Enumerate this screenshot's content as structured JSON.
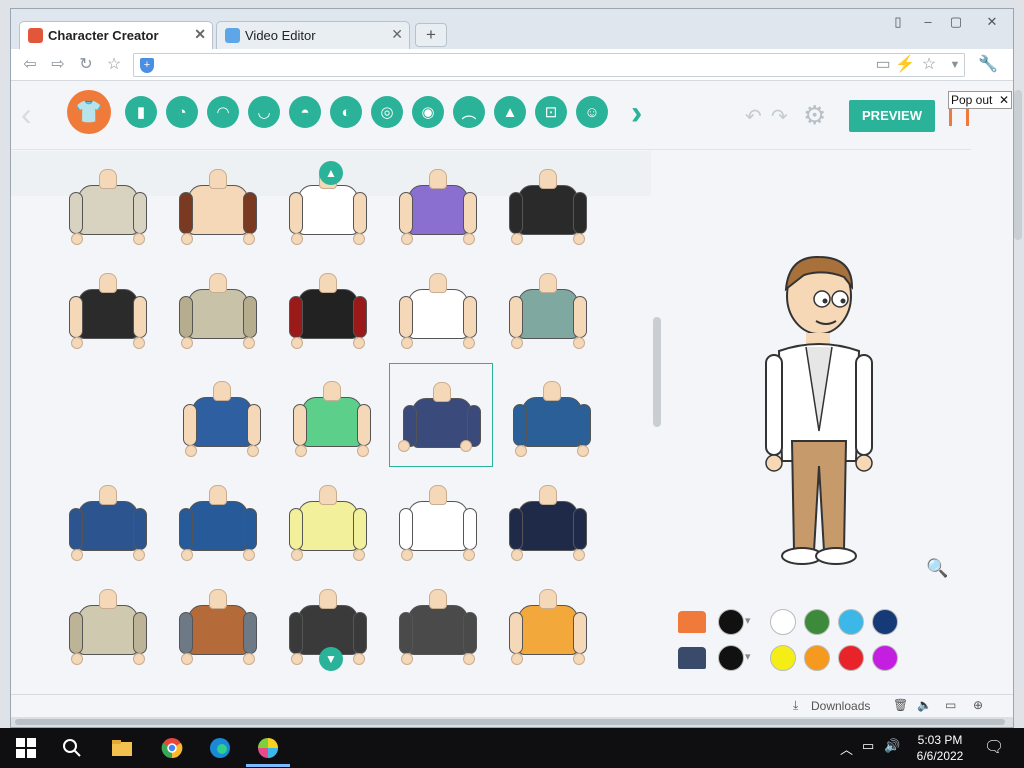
{
  "browser": {
    "tabs": [
      {
        "title": "Character Creator",
        "active": true,
        "favicon_color": "#e2573b"
      },
      {
        "title": "Video Editor",
        "active": false,
        "favicon_color": "#5fa6e8"
      }
    ],
    "new_tab_label": "+",
    "window_controls": [
      "▯",
      "–",
      "▢",
      "✕"
    ]
  },
  "nav": {
    "back": "⇦",
    "forward": "⇨",
    "reload": "↻",
    "bookmark": "☆",
    "url": "",
    "right_icons": [
      "▭",
      "⚡",
      "☆",
      "▼",
      "🔧"
    ]
  },
  "app": {
    "categories": [
      {
        "name": "shirt",
        "glyph": "👕",
        "active": true
      },
      {
        "name": "pants",
        "glyph": "▮"
      },
      {
        "name": "face",
        "glyph": "◔"
      },
      {
        "name": "hair",
        "glyph": "◠"
      },
      {
        "name": "beard",
        "glyph": "◡"
      },
      {
        "name": "mouth",
        "glyph": "◓"
      },
      {
        "name": "ear",
        "glyph": "◐"
      },
      {
        "name": "nose",
        "glyph": "◎"
      },
      {
        "name": "eye",
        "glyph": "◉"
      },
      {
        "name": "eyebrow",
        "glyph": "︵"
      },
      {
        "name": "body",
        "glyph": "▲"
      },
      {
        "name": "glasses",
        "glyph": "⊡"
      },
      {
        "name": "accessory",
        "glyph": "☺"
      }
    ],
    "undo": "↶",
    "redo": "↷",
    "gear": "⚙",
    "preview_label": "PREVIEW",
    "popout_label": "Pop out",
    "popout_close": "✕",
    "scroll_up": "▲",
    "scroll_down": "▼",
    "zoom": "🔍",
    "outfits": [
      {
        "shirt": "#d8d2c0",
        "arm": "#d8d2c0",
        "row": 0,
        "col": 0
      },
      {
        "shirt": "#f4d8b8",
        "arm": "#7a3a22",
        "row": 0,
        "col": 1
      },
      {
        "shirt": "#ffffff",
        "arm": "#f4d8b8",
        "row": 0,
        "col": 2
      },
      {
        "shirt": "#8a6fd1",
        "arm": "#f4d8b8",
        "row": 0,
        "col": 3
      },
      {
        "shirt": "#2a2a2a",
        "arm": "#2a2a2a",
        "row": 0,
        "col": 4
      },
      {
        "shirt": "#2b2b2b",
        "arm": "#f4d8b8",
        "row": 1,
        "col": 0
      },
      {
        "shirt": "#c8c2a8",
        "arm": "#b6ad8e",
        "row": 1,
        "col": 1
      },
      {
        "shirt": "#222222",
        "arm": "#9a1a1a",
        "row": 1,
        "col": 2
      },
      {
        "shirt": "#ffffff",
        "arm": "#f4d8b8",
        "row": 1,
        "col": 3
      },
      {
        "shirt": "#7fa8a0",
        "arm": "#f4d8b8",
        "row": 1,
        "col": 4
      },
      {
        "shirt": "#2e5fa0",
        "arm": "#f4d8b8",
        "row": 2,
        "col": 1
      },
      {
        "shirt": "#5ccf8a",
        "arm": "#f4d8b8",
        "row": 2,
        "col": 2
      },
      {
        "shirt": "#3a4a7a",
        "arm": "#3a4a7a",
        "row": 2,
        "col": 3,
        "selected": true
      },
      {
        "shirt": "#2a5f98",
        "arm": "#2a5f98",
        "row": 2,
        "col": 4
      },
      {
        "shirt": "#2c5590",
        "arm": "#2c5590",
        "row": 3,
        "col": 0
      },
      {
        "shirt": "#275a98",
        "arm": "#275a98",
        "row": 3,
        "col": 1
      },
      {
        "shirt": "#f2f09a",
        "arm": "#f2f09a",
        "row": 3,
        "col": 2
      },
      {
        "shirt": "#ffffff",
        "arm": "#ffffff",
        "row": 3,
        "col": 3
      },
      {
        "shirt": "#1e2a48",
        "arm": "#1e2a48",
        "row": 3,
        "col": 4
      },
      {
        "shirt": "#cfc9b0",
        "arm": "#bdb396",
        "row": 4,
        "col": 0
      },
      {
        "shirt": "#b56a3a",
        "arm": "#6d7a86",
        "row": 4,
        "col": 1
      },
      {
        "shirt": "#3a3a3a",
        "arm": "#3a3a3a",
        "row": 4,
        "col": 2
      },
      {
        "shirt": "#4a4a4a",
        "arm": "#4a4a4a",
        "row": 4,
        "col": 3
      },
      {
        "shirt": "#f2a83a",
        "arm": "#f4d8b8",
        "row": 4,
        "col": 4
      }
    ],
    "swatch_rows": [
      {
        "icon_color": "#f07a3a",
        "colors": [
          "#111111",
          "#ffffff",
          "#3d8a3d",
          "#3bb8e8",
          "#163a78"
        ]
      },
      {
        "icon_color": "#3a4a6a",
        "colors": [
          "#111111",
          "#f5ee16",
          "#f59a1e",
          "#e8242a",
          "#c41ee0"
        ]
      }
    ]
  },
  "status": {
    "downloads": "Downloads"
  },
  "taskbar": {
    "time": "5:03 PM",
    "date": "6/6/2022"
  }
}
